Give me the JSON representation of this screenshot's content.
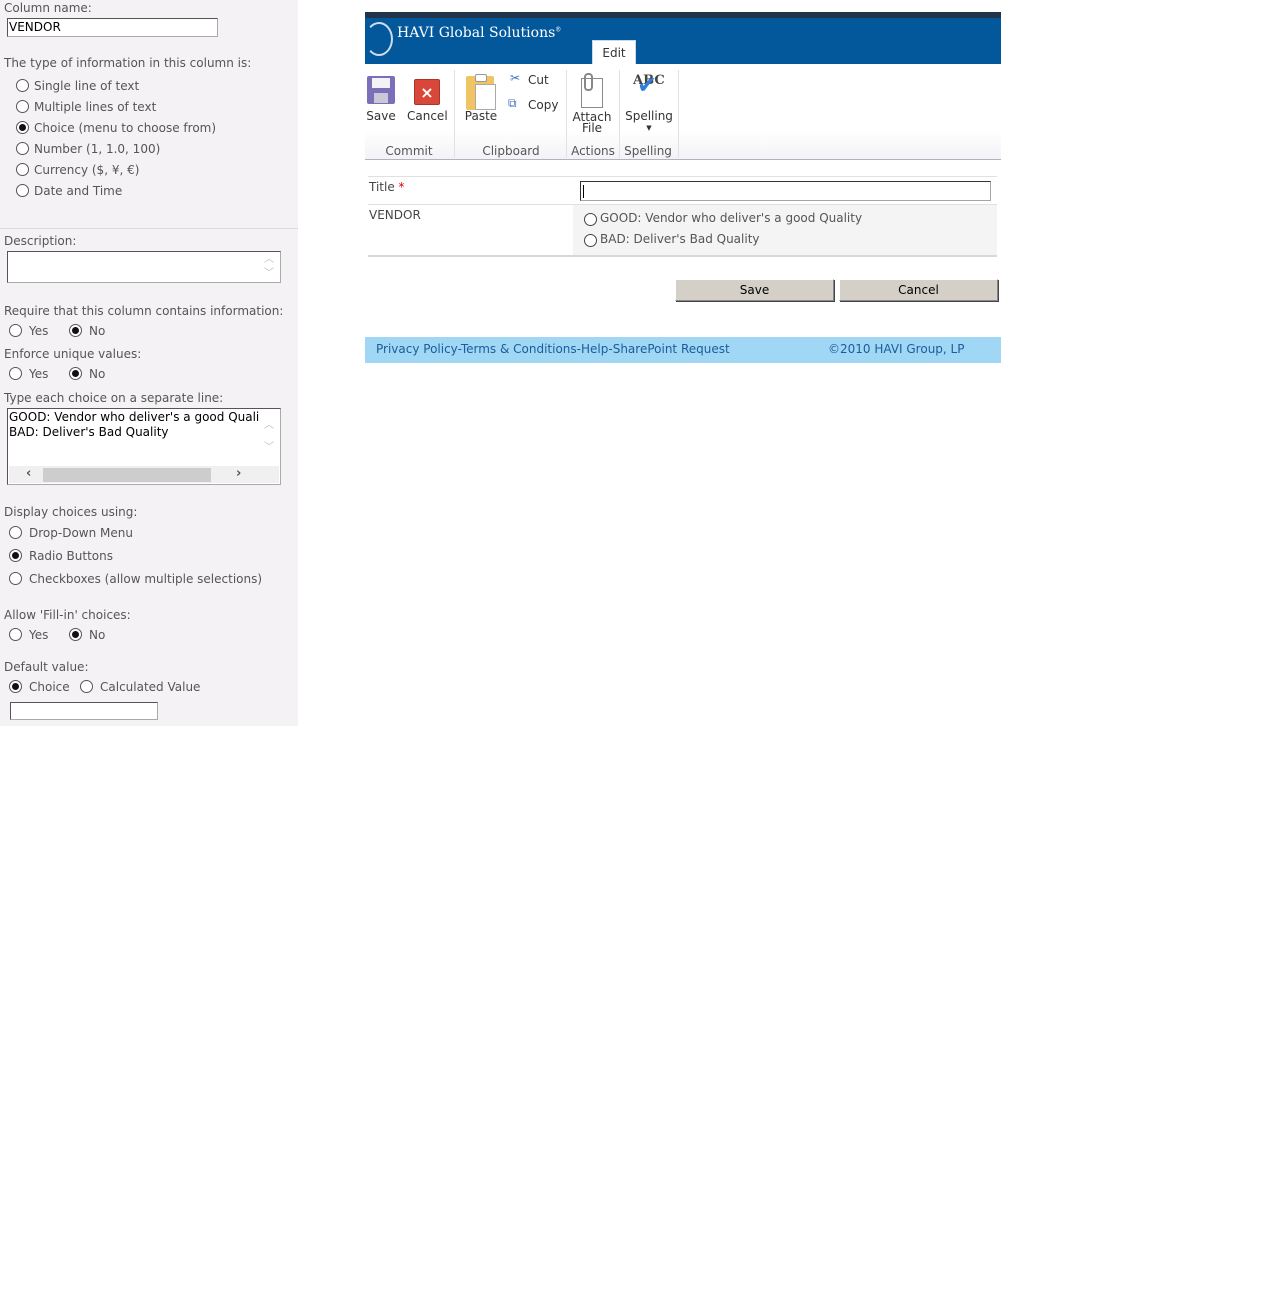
{
  "column_settings": {
    "column_name_label": "Column name:",
    "column_name_value": "VENDOR",
    "type_label": "The type of information in this column is:",
    "types": [
      {
        "label": "Single line of text",
        "checked": false
      },
      {
        "label": "Multiple lines of text",
        "checked": false
      },
      {
        "label": "Choice (menu to choose from)",
        "checked": true
      },
      {
        "label": "Number (1, 1.0, 100)",
        "checked": false
      },
      {
        "label": "Currency ($, ¥, €)",
        "checked": false
      },
      {
        "label": "Date and Time",
        "checked": false
      }
    ],
    "description_label": "Description:",
    "description_value": "",
    "require_label": "Require that this column contains information:",
    "require": {
      "yes": "Yes",
      "no": "No",
      "selected": "No"
    },
    "unique_label": "Enforce unique values:",
    "unique": {
      "yes": "Yes",
      "no": "No",
      "selected": "No"
    },
    "choices_label": "Type each choice on a separate line:",
    "choices_text": "GOOD: Vendor who deliver's a good Quali\nBAD: Deliver's Bad Quality",
    "display_label": "Display choices using:",
    "display_options": [
      {
        "label": "Drop-Down Menu",
        "checked": false
      },
      {
        "label": "Radio Buttons",
        "checked": true
      },
      {
        "label": "Checkboxes (allow multiple selections)",
        "checked": false
      }
    ],
    "fillin_label": "Allow 'Fill-in' choices:",
    "fillin": {
      "yes": "Yes",
      "no": "No",
      "selected": "No"
    },
    "default_label": "Default value:",
    "default": {
      "choice": "Choice",
      "calculated": "Calculated Value",
      "selected": "Choice",
      "value": ""
    }
  },
  "form": {
    "brand": "HAVI Global Solutions",
    "brand_mark": "®",
    "active_tab": "Edit",
    "ribbon": {
      "save": "Save",
      "cancel": "Cancel",
      "paste": "Paste",
      "cut": "Cut",
      "copy": "Copy",
      "attach_line1": "Attach",
      "attach_line2": "File",
      "spelling": "Spelling",
      "groups": {
        "commit": "Commit",
        "clipboard": "Clipboard",
        "actions": "Actions",
        "spelling": "Spelling"
      }
    },
    "fields": {
      "title_label": "Title",
      "required_mark": "*",
      "title_value": "",
      "vendor_label": "VENDOR",
      "vendor_options": [
        {
          "label": "GOOD: Vendor who deliver's a good Quality",
          "checked": false
        },
        {
          "label": "BAD: Deliver's Bad Quality",
          "checked": false
        }
      ]
    },
    "buttons": {
      "save": "Save",
      "cancel": "Cancel"
    },
    "footer": {
      "links": [
        "Privacy Policy",
        "Terms & Conditions",
        "Help",
        "SharePoint Request"
      ],
      "separator": "-",
      "copyright": "©2010 HAVI Group, LP"
    },
    "colors": {
      "banner": "#03589c",
      "topbar": "#21344a",
      "footer": "#9fd7f5",
      "footer_text": "#1a5d9a"
    }
  }
}
